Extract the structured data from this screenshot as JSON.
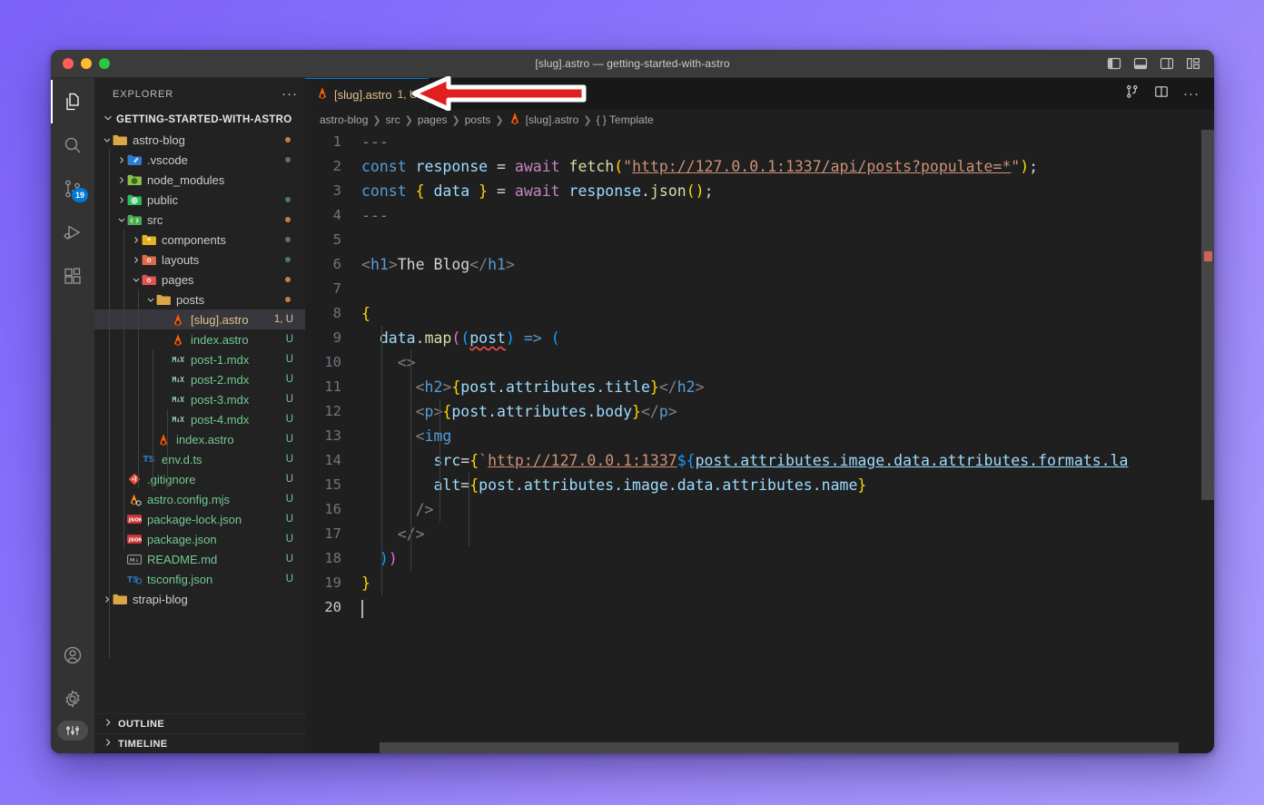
{
  "window": {
    "title": "[slug].astro — getting-started-with-astro",
    "traffic_lights": [
      "close",
      "minimize",
      "zoom"
    ],
    "titlebar_actions": [
      {
        "name": "toggle-primary-sidebar-icon"
      },
      {
        "name": "toggle-panel-icon"
      },
      {
        "name": "toggle-secondary-sidebar-icon"
      },
      {
        "name": "customize-layout-icon"
      }
    ]
  },
  "activitybar": {
    "items": [
      {
        "name": "explorer",
        "icon": "files-icon",
        "active": true,
        "badge": ""
      },
      {
        "name": "search",
        "icon": "search-icon",
        "active": false,
        "badge": ""
      },
      {
        "name": "source-control",
        "icon": "source-control-icon",
        "active": false,
        "badge": "19"
      },
      {
        "name": "run-and-debug",
        "icon": "run-debug-icon",
        "active": false,
        "badge": ""
      },
      {
        "name": "extensions",
        "icon": "extensions-icon",
        "active": false,
        "badge": ""
      }
    ],
    "bottom": [
      {
        "name": "accounts",
        "icon": "account-icon"
      },
      {
        "name": "manage",
        "icon": "gear-icon"
      }
    ],
    "pill": {
      "name": "tune-icon"
    }
  },
  "sidebar": {
    "header": {
      "title": "EXPLORER",
      "more": "···"
    },
    "root": {
      "label": "GETTING-STARTED-WITH-ASTRO",
      "expanded": true
    },
    "tree": [
      {
        "label": "astro-blog",
        "depth": 1,
        "type": "folder",
        "state": "expanded",
        "icon": "folder-astro-icon",
        "status": "",
        "marker": "mod"
      },
      {
        "label": ".vscode",
        "depth": 2,
        "type": "folder",
        "state": "collapsed",
        "icon": "folder-vscode-icon",
        "status": "",
        "marker": "untracked"
      },
      {
        "label": "node_modules",
        "depth": 2,
        "type": "folder",
        "state": "collapsed",
        "icon": "folder-node-icon",
        "status": "",
        "marker": ""
      },
      {
        "label": "public",
        "depth": 2,
        "type": "folder",
        "state": "collapsed",
        "icon": "folder-public-icon",
        "status": "",
        "marker": "untracked"
      },
      {
        "label": "src",
        "depth": 2,
        "type": "folder",
        "state": "expanded",
        "icon": "folder-src-icon",
        "status": "",
        "marker": "mod"
      },
      {
        "label": "components",
        "depth": 3,
        "type": "folder",
        "state": "collapsed",
        "icon": "folder-components-icon",
        "status": "",
        "marker": "untracked"
      },
      {
        "label": "layouts",
        "depth": 3,
        "type": "folder",
        "state": "collapsed",
        "icon": "folder-layouts-icon",
        "status": "",
        "marker": "untracked"
      },
      {
        "label": "pages",
        "depth": 3,
        "type": "folder",
        "state": "expanded",
        "icon": "folder-pages-icon",
        "status": "",
        "marker": "mod"
      },
      {
        "label": "posts",
        "depth": 4,
        "type": "folder",
        "state": "expanded",
        "icon": "folder-posts-icon",
        "status": "",
        "marker": "mod"
      },
      {
        "label": "[slug].astro",
        "depth": 5,
        "type": "file",
        "state": "",
        "icon": "astro-file-icon",
        "status": "1, U",
        "marker": "",
        "selected": true,
        "color": "mod"
      },
      {
        "label": "index.astro",
        "depth": 5,
        "type": "file",
        "state": "",
        "icon": "astro-file-icon",
        "status": "U",
        "marker": "",
        "color": "untracked"
      },
      {
        "label": "post-1.mdx",
        "depth": 5,
        "type": "file",
        "state": "",
        "icon": "mdx-file-icon",
        "status": "U",
        "marker": "",
        "color": "untracked"
      },
      {
        "label": "post-2.mdx",
        "depth": 5,
        "type": "file",
        "state": "",
        "icon": "mdx-file-icon",
        "status": "U",
        "marker": "",
        "color": "untracked"
      },
      {
        "label": "post-3.mdx",
        "depth": 5,
        "type": "file",
        "state": "",
        "icon": "mdx-file-icon",
        "status": "U",
        "marker": "",
        "color": "untracked"
      },
      {
        "label": "post-4.mdx",
        "depth": 5,
        "type": "file",
        "state": "",
        "icon": "mdx-file-icon",
        "status": "U",
        "marker": "",
        "color": "untracked"
      },
      {
        "label": "index.astro",
        "depth": 4,
        "type": "file",
        "state": "",
        "icon": "astro-file-icon",
        "status": "U",
        "marker": "",
        "color": "untracked"
      },
      {
        "label": "env.d.ts",
        "depth": 3,
        "type": "file",
        "state": "",
        "icon": "ts-file-icon",
        "status": "U",
        "marker": "",
        "color": "untracked"
      },
      {
        "label": ".gitignore",
        "depth": 2,
        "type": "file",
        "state": "",
        "icon": "git-file-icon",
        "status": "U",
        "marker": "",
        "color": "untracked"
      },
      {
        "label": "astro.config.mjs",
        "depth": 2,
        "type": "file",
        "state": "",
        "icon": "astro-config-icon",
        "status": "U",
        "marker": "",
        "color": "untracked"
      },
      {
        "label": "package-lock.json",
        "depth": 2,
        "type": "file",
        "state": "",
        "icon": "npm-lock-icon",
        "status": "U",
        "marker": "",
        "color": "untracked"
      },
      {
        "label": "package.json",
        "depth": 2,
        "type": "file",
        "state": "",
        "icon": "npm-icon",
        "status": "U",
        "marker": "",
        "color": "untracked"
      },
      {
        "label": "README.md",
        "depth": 2,
        "type": "file",
        "state": "",
        "icon": "markdown-file-icon",
        "status": "U",
        "marker": "",
        "color": "untracked"
      },
      {
        "label": "tsconfig.json",
        "depth": 2,
        "type": "file",
        "state": "",
        "icon": "tsconfig-file-icon",
        "status": "U",
        "marker": "",
        "color": "untracked"
      },
      {
        "label": "strapi-blog",
        "depth": 1,
        "type": "folder",
        "state": "collapsed",
        "icon": "folder-icon",
        "status": "",
        "marker": ""
      }
    ],
    "panels": [
      {
        "label": "OUTLINE",
        "expanded": false
      },
      {
        "label": "TIMELINE",
        "expanded": false
      }
    ]
  },
  "editor": {
    "tab": {
      "label": "[slug].astro",
      "status": "1, U",
      "icon": "astro-file-icon"
    },
    "tab_actions": [
      {
        "name": "split-in-group-icon"
      },
      {
        "name": "split-editor-right-icon"
      },
      {
        "name": "more-actions-icon"
      }
    ],
    "breadcrumb": [
      "astro-blog",
      "src",
      "pages",
      "posts",
      "[slug].astro",
      "{ } Template"
    ],
    "lines": [
      {
        "n": 1,
        "text": "---"
      },
      {
        "n": 2,
        "text": "const response = await fetch(\"http://127.0.0.1:1337/api/posts?populate=*\");"
      },
      {
        "n": 3,
        "text": "const { data } = await response.json();"
      },
      {
        "n": 4,
        "text": "---"
      },
      {
        "n": 5,
        "text": ""
      },
      {
        "n": 6,
        "text": "<h1>The Blog</h1>"
      },
      {
        "n": 7,
        "text": ""
      },
      {
        "n": 8,
        "text": "{"
      },
      {
        "n": 9,
        "text": "  data.map((post) => ("
      },
      {
        "n": 10,
        "text": "    <>"
      },
      {
        "n": 11,
        "text": "      <h2>{post.attributes.title}</h2>"
      },
      {
        "n": 12,
        "text": "      <p>{post.attributes.body}</p>"
      },
      {
        "n": 13,
        "text": "      <img"
      },
      {
        "n": 14,
        "text": "        src={`http://127.0.0.1:1337${post.attributes.image.data.attributes.formats.la"
      },
      {
        "n": 15,
        "text": "        alt={post.attributes.image.data.attributes.name}"
      },
      {
        "n": 16,
        "text": "      />"
      },
      {
        "n": 17,
        "text": "    </>"
      },
      {
        "n": 18,
        "text": "  ))"
      },
      {
        "n": 19,
        "text": "}"
      },
      {
        "n": 20,
        "text": ""
      }
    ],
    "cursor_line": 20
  },
  "annotation": {
    "arrow": {
      "name": "red-left-arrow",
      "direction": "left",
      "fill": "#e02020",
      "stroke": "#ffffff"
    }
  },
  "colors": {
    "desktop_gradient_start": "#7b61f8",
    "desktop_gradient_end": "#a89bfc",
    "editor_bg": "#1f1f1f",
    "sidebar_bg": "#222222",
    "activitybar_bg": "#333333",
    "titlebar_bg": "#3b3b3b",
    "tabbar_bg": "#181818",
    "accent": "#0078d4",
    "modified": "#e2c08d",
    "untracked": "#73c991",
    "error": "#f14c4c"
  }
}
